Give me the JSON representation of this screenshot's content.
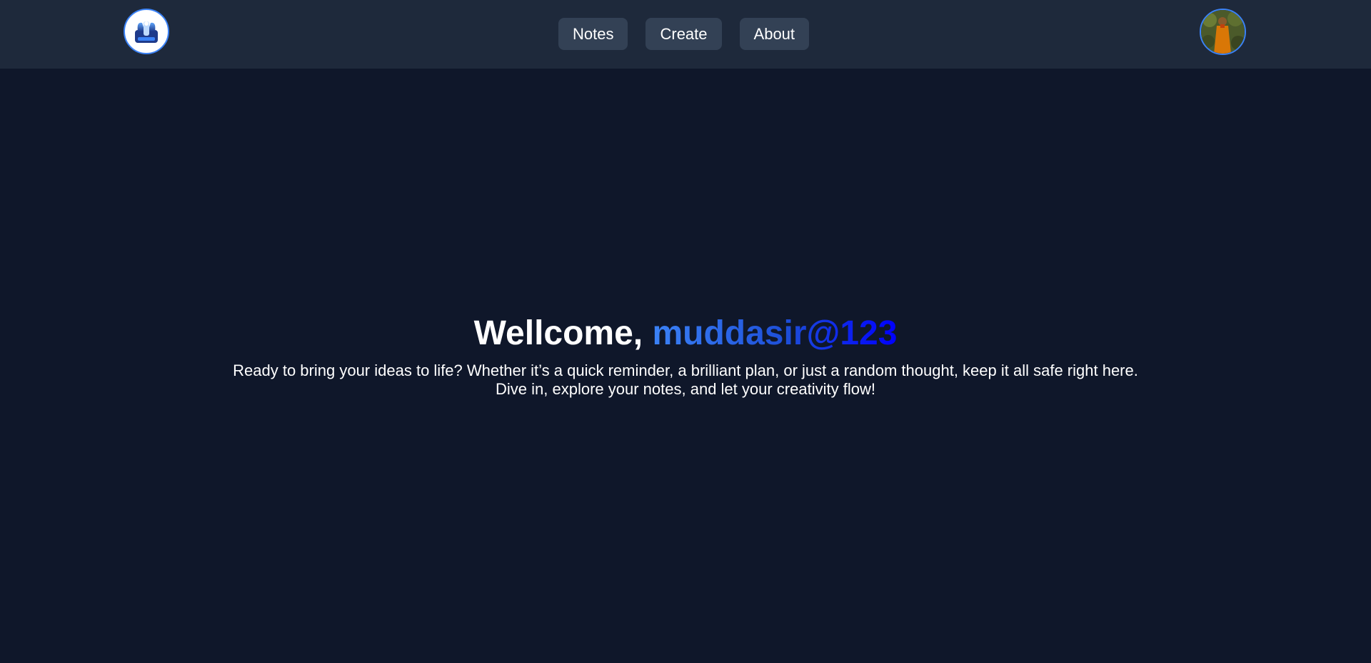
{
  "app": {
    "logo_icon": "notebook-logo-icon",
    "avatar_icon": "user-profile-avatar"
  },
  "nav": {
    "items": [
      {
        "label": "Notes"
      },
      {
        "label": "Create"
      },
      {
        "label": "About"
      }
    ]
  },
  "hero": {
    "greeting": "Wellcome,",
    "username": "muddasir@123",
    "line1": "Ready to bring your ideas to life? Whether it’s a quick reminder, a brilliant plan, or just a random thought, keep it all safe right here.",
    "line2": "Dive in, explore your notes, and let your creativity flow!"
  },
  "colors": {
    "background": "#0f172a",
    "navbar": "#1e293b",
    "nav_button": "#334155",
    "accent": "#3b82f6",
    "username_gradient_end": "#0000ff"
  }
}
